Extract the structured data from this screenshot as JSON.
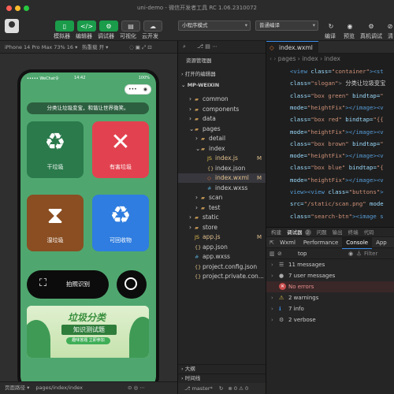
{
  "window": {
    "title": "uni-demo - 微信开发者工具 RC 1.06.2310072"
  },
  "toolbar": {
    "buttons": [
      {
        "label": "模拟器",
        "icon": "phone-icon",
        "active": true
      },
      {
        "label": "编辑器",
        "icon": "code-icon",
        "active": true
      },
      {
        "label": "调试器",
        "icon": "debug-icon",
        "active": true
      },
      {
        "label": "可视化",
        "icon": "visual-icon",
        "active": false
      },
      {
        "label": "云开发",
        "icon": "cloud-icon",
        "active": false
      }
    ],
    "mode_select": "小程序模式",
    "compile_select": "普通编译",
    "right_buttons": [
      {
        "label": "编译",
        "icon": "refresh-icon"
      },
      {
        "label": "预览",
        "icon": "eye-icon"
      },
      {
        "label": "真机调试",
        "icon": "device-debug-icon"
      },
      {
        "label": "清",
        "icon": "clear-icon"
      }
    ]
  },
  "simulator": {
    "device": "iPhone 14 Pro Max 73% 16 ▾",
    "hot_reload": "热重载 开 ▾",
    "status_time": "••••• WeChat令",
    "status_clock": "14:42",
    "status_battery": "100%",
    "capsule_dots": "•••",
    "slogan": "分类让垃圾变宝，和谐让世界微笑。",
    "boxes": [
      {
        "label": "干垃圾",
        "color": "#2a7a4b",
        "icon": "♻"
      },
      {
        "label": "有害垃圾",
        "color": "#e2424f",
        "icon": "✕"
      },
      {
        "label": "湿垃圾",
        "color": "#8a4e22",
        "icon": "⧗"
      },
      {
        "label": "可回收物",
        "color": "#2f7de0",
        "icon": "♻"
      }
    ],
    "scan_label": "拍照识别",
    "banner_title": "垃圾分类",
    "banner_subtitle": "知识测试题",
    "banner_button": "趣味答题 立即参加"
  },
  "explorer": {
    "title": "资源管理器",
    "open_editors": "打开的编辑器",
    "root": "MP-WEIXIN",
    "items": [
      {
        "label": "common",
        "kind": "folder",
        "depth": 1,
        "marker": ""
      },
      {
        "label": "components",
        "kind": "folder",
        "depth": 1,
        "marker": ""
      },
      {
        "label": "data",
        "kind": "folder",
        "depth": 1,
        "marker": ""
      },
      {
        "label": "pages",
        "kind": "folder-open",
        "depth": 1,
        "marker": ""
      },
      {
        "label": "detail",
        "kind": "folder",
        "depth": 2,
        "marker": ""
      },
      {
        "label": "index",
        "kind": "folder-open",
        "depth": 2,
        "marker": ""
      },
      {
        "label": "index.js",
        "kind": "js",
        "depth": 3,
        "marker": "M"
      },
      {
        "label": "index.json",
        "kind": "json",
        "depth": 3,
        "marker": ""
      },
      {
        "label": "index.wxml",
        "kind": "wxml",
        "depth": 3,
        "marker": "M"
      },
      {
        "label": "index.wxss",
        "kind": "wxss",
        "depth": 3,
        "marker": ""
      },
      {
        "label": "scan",
        "kind": "folder",
        "depth": 2,
        "marker": ""
      },
      {
        "label": "test",
        "kind": "folder",
        "depth": 2,
        "marker": ""
      },
      {
        "label": "static",
        "kind": "folder",
        "depth": 1,
        "marker": ""
      },
      {
        "label": "store",
        "kind": "folder",
        "depth": 1,
        "marker": ""
      },
      {
        "label": "app.js",
        "kind": "js",
        "depth": 1,
        "marker": "M"
      },
      {
        "label": "app.json",
        "kind": "json",
        "depth": 1,
        "marker": ""
      },
      {
        "label": "app.wxss",
        "kind": "wxss",
        "depth": 1,
        "marker": ""
      },
      {
        "label": "project.config.json",
        "kind": "json",
        "depth": 1,
        "marker": ""
      },
      {
        "label": "project.private.con...",
        "kind": "json",
        "depth": 1,
        "marker": ""
      }
    ],
    "outline": "大纲",
    "timeline": "时间线"
  },
  "editor": {
    "tab": "index.wxml",
    "breadcrumb": "pages › index › index",
    "lines": [
      [
        {
          "t": "<view ",
          "c": "#569cd6"
        },
        {
          "t": "class=",
          "c": "#9cdcfe"
        },
        {
          "t": "\"container\"",
          "c": "#ce9178"
        },
        {
          "t": "><st",
          "c": "#569cd6"
        }
      ],
      [
        {
          "t": "class=",
          "c": "#9cdcfe"
        },
        {
          "t": "\"slogan\"",
          "c": "#ce9178"
        },
        {
          "t": "> ",
          "c": "#808080"
        },
        {
          "t": "分类让垃圾变宝",
          "c": "#d4d4d4"
        }
      ],
      [
        {
          "t": "class=",
          "c": "#9cdcfe"
        },
        {
          "t": "\"box green\" ",
          "c": "#ce9178"
        },
        {
          "t": "bindtap=",
          "c": "#9cdcfe"
        },
        {
          "t": "\"",
          "c": "#ce9178"
        }
      ],
      [
        {
          "t": "mode=",
          "c": "#9cdcfe"
        },
        {
          "t": "\"heightFix\"",
          "c": "#ce9178"
        },
        {
          "t": "></image><v",
          "c": "#569cd6"
        }
      ],
      [
        {
          "t": "class=",
          "c": "#9cdcfe"
        },
        {
          "t": "\"box red\" ",
          "c": "#ce9178"
        },
        {
          "t": "bindtap=",
          "c": "#9cdcfe"
        },
        {
          "t": "\"{{",
          "c": "#ce9178"
        }
      ],
      [
        {
          "t": "mode=",
          "c": "#9cdcfe"
        },
        {
          "t": "\"heightFix\"",
          "c": "#ce9178"
        },
        {
          "t": "></image><v",
          "c": "#569cd6"
        }
      ],
      [
        {
          "t": "class=",
          "c": "#9cdcfe"
        },
        {
          "t": "\"box brown\" ",
          "c": "#ce9178"
        },
        {
          "t": "bindtap=",
          "c": "#9cdcfe"
        },
        {
          "t": "\"",
          "c": "#ce9178"
        }
      ],
      [
        {
          "t": "mode=",
          "c": "#9cdcfe"
        },
        {
          "t": "\"heightFix\"",
          "c": "#ce9178"
        },
        {
          "t": "></image><v",
          "c": "#569cd6"
        }
      ],
      [
        {
          "t": "class=",
          "c": "#9cdcfe"
        },
        {
          "t": "\"box blue\" ",
          "c": "#ce9178"
        },
        {
          "t": "bindtap=",
          "c": "#9cdcfe"
        },
        {
          "t": "\"{",
          "c": "#ce9178"
        }
      ],
      [
        {
          "t": "mode=",
          "c": "#9cdcfe"
        },
        {
          "t": "\"heightFix\"",
          "c": "#ce9178"
        },
        {
          "t": "></image><v",
          "c": "#569cd6"
        }
      ],
      [
        {
          "t": "view><view ",
          "c": "#569cd6"
        },
        {
          "t": "class=",
          "c": "#9cdcfe"
        },
        {
          "t": "\"buttons\"",
          "c": "#ce9178"
        },
        {
          "t": ">",
          "c": "#569cd6"
        }
      ],
      [
        {
          "t": "src=",
          "c": "#9cdcfe"
        },
        {
          "t": "\"/static/scan.png\"",
          "c": "#ce9178"
        },
        {
          "t": " mode",
          "c": "#9cdcfe"
        }
      ],
      [
        {
          "t": "class=",
          "c": "#9cdcfe"
        },
        {
          "t": "\"search-btn\"",
          "c": "#ce9178"
        },
        {
          "t": "><image s",
          "c": "#569cd6"
        }
      ]
    ]
  },
  "debug": {
    "panel_tabs": [
      "构建",
      "调试器",
      "2",
      "问题",
      "输出",
      "终端",
      "代码"
    ],
    "devtool_tabs": [
      "Wxml",
      "Performance",
      "Console",
      "App"
    ],
    "context": "top",
    "filter": "Filter",
    "messages": [
      {
        "label": "11 messages",
        "icon": "list-icon",
        "kind": "normal"
      },
      {
        "label": "7 user messages",
        "icon": "user-icon",
        "kind": "normal"
      },
      {
        "label": "No errors",
        "icon": "error-icon",
        "kind": "error"
      },
      {
        "label": "2 warnings",
        "icon": "warning-icon",
        "kind": "warning"
      },
      {
        "label": "7 info",
        "icon": "info-icon",
        "kind": "info"
      },
      {
        "label": "2 verbose",
        "icon": "verbose-icon",
        "kind": "verbose"
      }
    ]
  },
  "statusbar": {
    "page_path_label": "页面路径 ▾",
    "page_path": "pages/index/index",
    "branch": "master*",
    "errors": "0",
    "warnings": "0"
  },
  "colors": {
    "accent": "#1a9c4a",
    "screen_bg": "#4fa76f",
    "selection": "#37373d"
  }
}
